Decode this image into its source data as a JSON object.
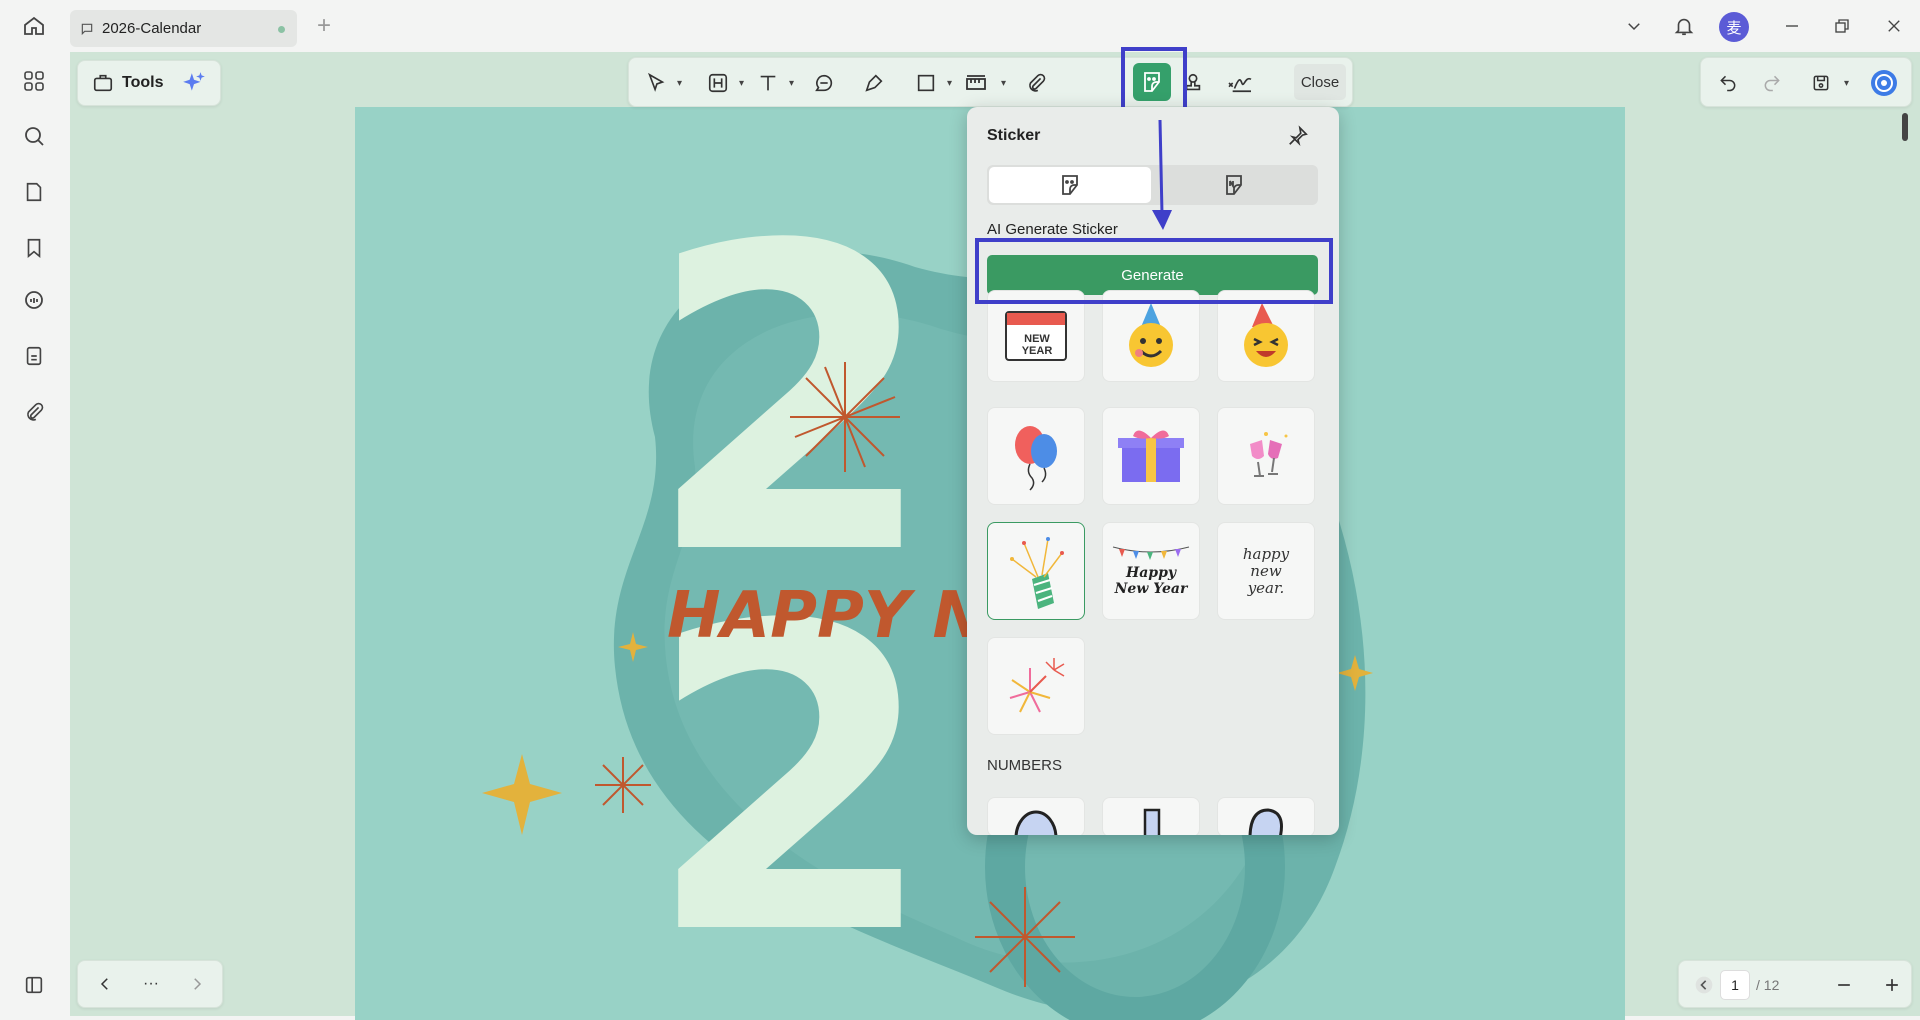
{
  "window": {
    "tab_title": "2026-Calendar",
    "avatar_char": "麦"
  },
  "toolbar": {
    "tools_label": "Tools",
    "close_label": "Close"
  },
  "canvas": {
    "headline": "HAPPY N",
    "big_digits": [
      "2",
      "2"
    ]
  },
  "sticker_panel": {
    "title": "Sticker",
    "ai_label": "AI Generate Sticker",
    "generate_label": "Generate",
    "numbers_label": "NUMBERS",
    "stickers": [
      {
        "name": "new-year-calendar",
        "text": "NEW YEAR"
      },
      {
        "name": "party-smiley"
      },
      {
        "name": "party-laughing-face"
      },
      {
        "name": "balloons"
      },
      {
        "name": "gift-box"
      },
      {
        "name": "champagne-toast"
      },
      {
        "name": "party-popper",
        "selected": true
      },
      {
        "name": "happy-new-year-banner",
        "text": "Happy New Year"
      },
      {
        "name": "happy-new-year-script",
        "text": "happy new year."
      },
      {
        "name": "fireworks"
      }
    ]
  },
  "pagination": {
    "current": "1",
    "total": "/ 12",
    "more": "···"
  },
  "colors": {
    "accent": "#3a9a62",
    "highlight": "#3f3fc9",
    "page_bg": "#98d2c6"
  }
}
